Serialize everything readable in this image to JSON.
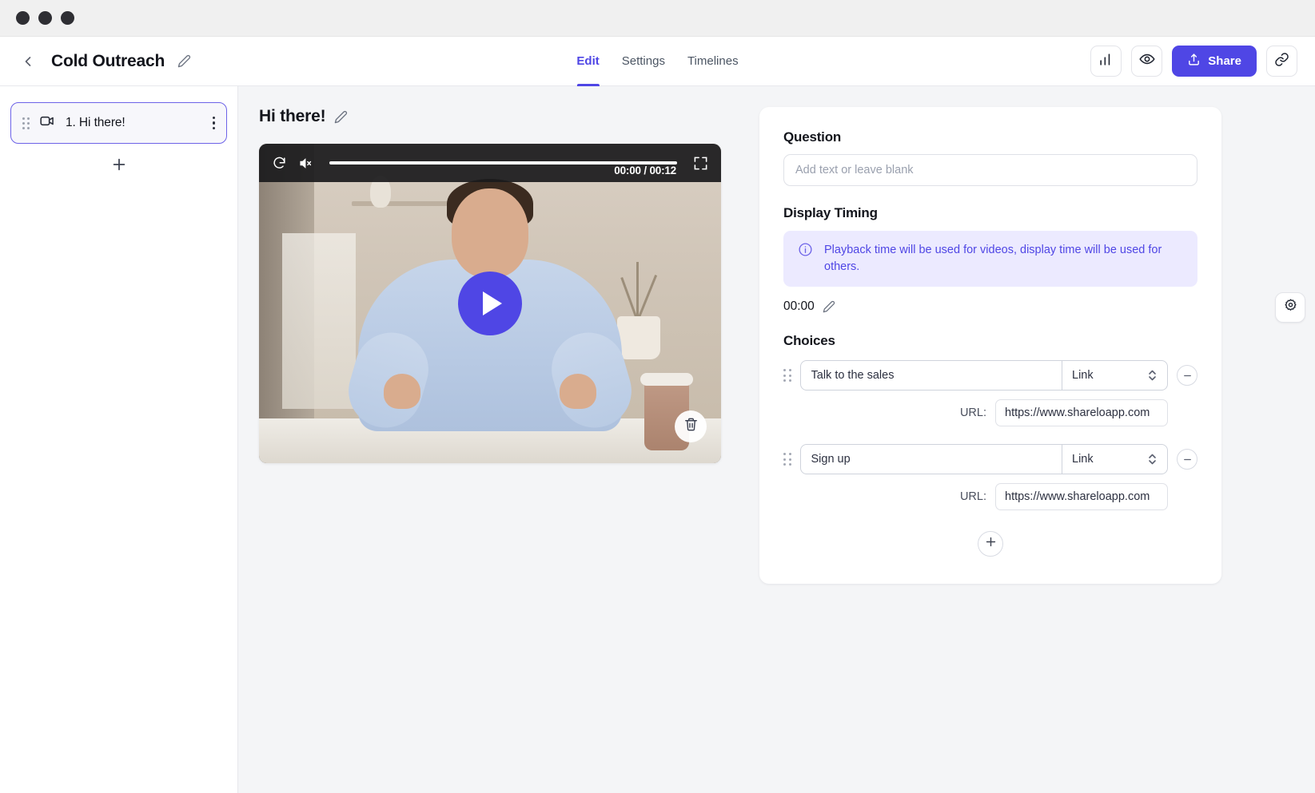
{
  "window": {
    "dots": 3
  },
  "header": {
    "back_icon": "chevron-left-icon",
    "project_title": "Cold Outreach",
    "edit_title_icon": "pencil-icon",
    "tabs": [
      {
        "label": "Edit",
        "active": true
      },
      {
        "label": "Settings",
        "active": false
      },
      {
        "label": "Timelines",
        "active": false
      }
    ],
    "actions": {
      "analytics_icon": "bar-chart-icon",
      "preview_icon": "eye-icon",
      "share_label": "Share",
      "share_icon": "upload-icon",
      "link_icon": "link-icon",
      "share_color": "#4f46e5"
    }
  },
  "sidebar": {
    "slides": [
      {
        "grip_icon": "drag-handle-icon",
        "type_icon": "video-camera-icon",
        "label": "1. Hi there!",
        "menu_icon": "kebab-menu-icon",
        "selected": true
      }
    ],
    "add_slide_icon": "plus-icon"
  },
  "main": {
    "slide_title": "Hi there!",
    "slide_title_edit_icon": "pencil-icon",
    "video": {
      "replay_icon": "replay-icon",
      "mute_icon": "volume-muted-icon",
      "fullscreen_icon": "fullscreen-icon",
      "time_display": "00:00 / 00:12",
      "current_time": "00:00",
      "duration": "00:12",
      "progress_percent": 0,
      "play_icon": "play-icon",
      "delete_icon": "trash-icon"
    }
  },
  "panel": {
    "question": {
      "heading": "Question",
      "value": "",
      "placeholder": "Add text or leave blank"
    },
    "display_timing": {
      "heading": "Display Timing",
      "info_icon": "info-circle-icon",
      "info_text": "Playback time will be used for videos, display time will be used for others.",
      "time_value": "00:00",
      "edit_icon": "pencil-icon"
    },
    "choices": {
      "heading": "Choices",
      "url_label": "URL:",
      "grip_icon": "drag-handle-icon",
      "stepper_icon": "chevron-updown-icon",
      "remove_icon": "minus-icon",
      "add_icon": "plus-icon",
      "items": [
        {
          "label": "Talk to the sales",
          "type": "Link",
          "url": "https://www.shareloapp.com"
        },
        {
          "label": "Sign up",
          "type": "Link",
          "url": "https://www.shareloapp.com"
        }
      ]
    }
  },
  "floating": {
    "settings_icon": "gear-icon"
  }
}
